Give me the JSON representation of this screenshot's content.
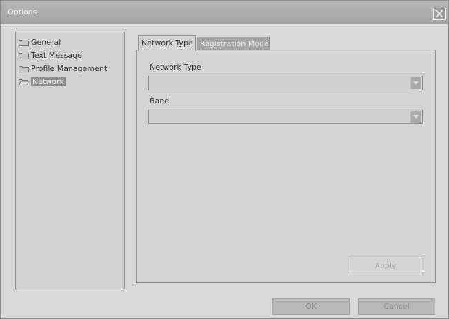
{
  "window": {
    "title": "Options"
  },
  "tree": {
    "items": [
      {
        "label": "General",
        "icon": "folder-icon",
        "selected": false
      },
      {
        "label": "Text Message",
        "icon": "folder-icon",
        "selected": false
      },
      {
        "label": "Profile Management",
        "icon": "folder-icon",
        "selected": false
      },
      {
        "label": "Network",
        "icon": "folder-open-icon",
        "selected": true
      }
    ]
  },
  "tabs": [
    {
      "label": "Network Type",
      "active": true
    },
    {
      "label": "Registration Mode",
      "active": false
    }
  ],
  "network_type": {
    "label": "Network Type",
    "value": ""
  },
  "band": {
    "label": "Band",
    "value": ""
  },
  "buttons": {
    "apply": "Apply",
    "ok": "OK",
    "cancel": "Cancel"
  }
}
